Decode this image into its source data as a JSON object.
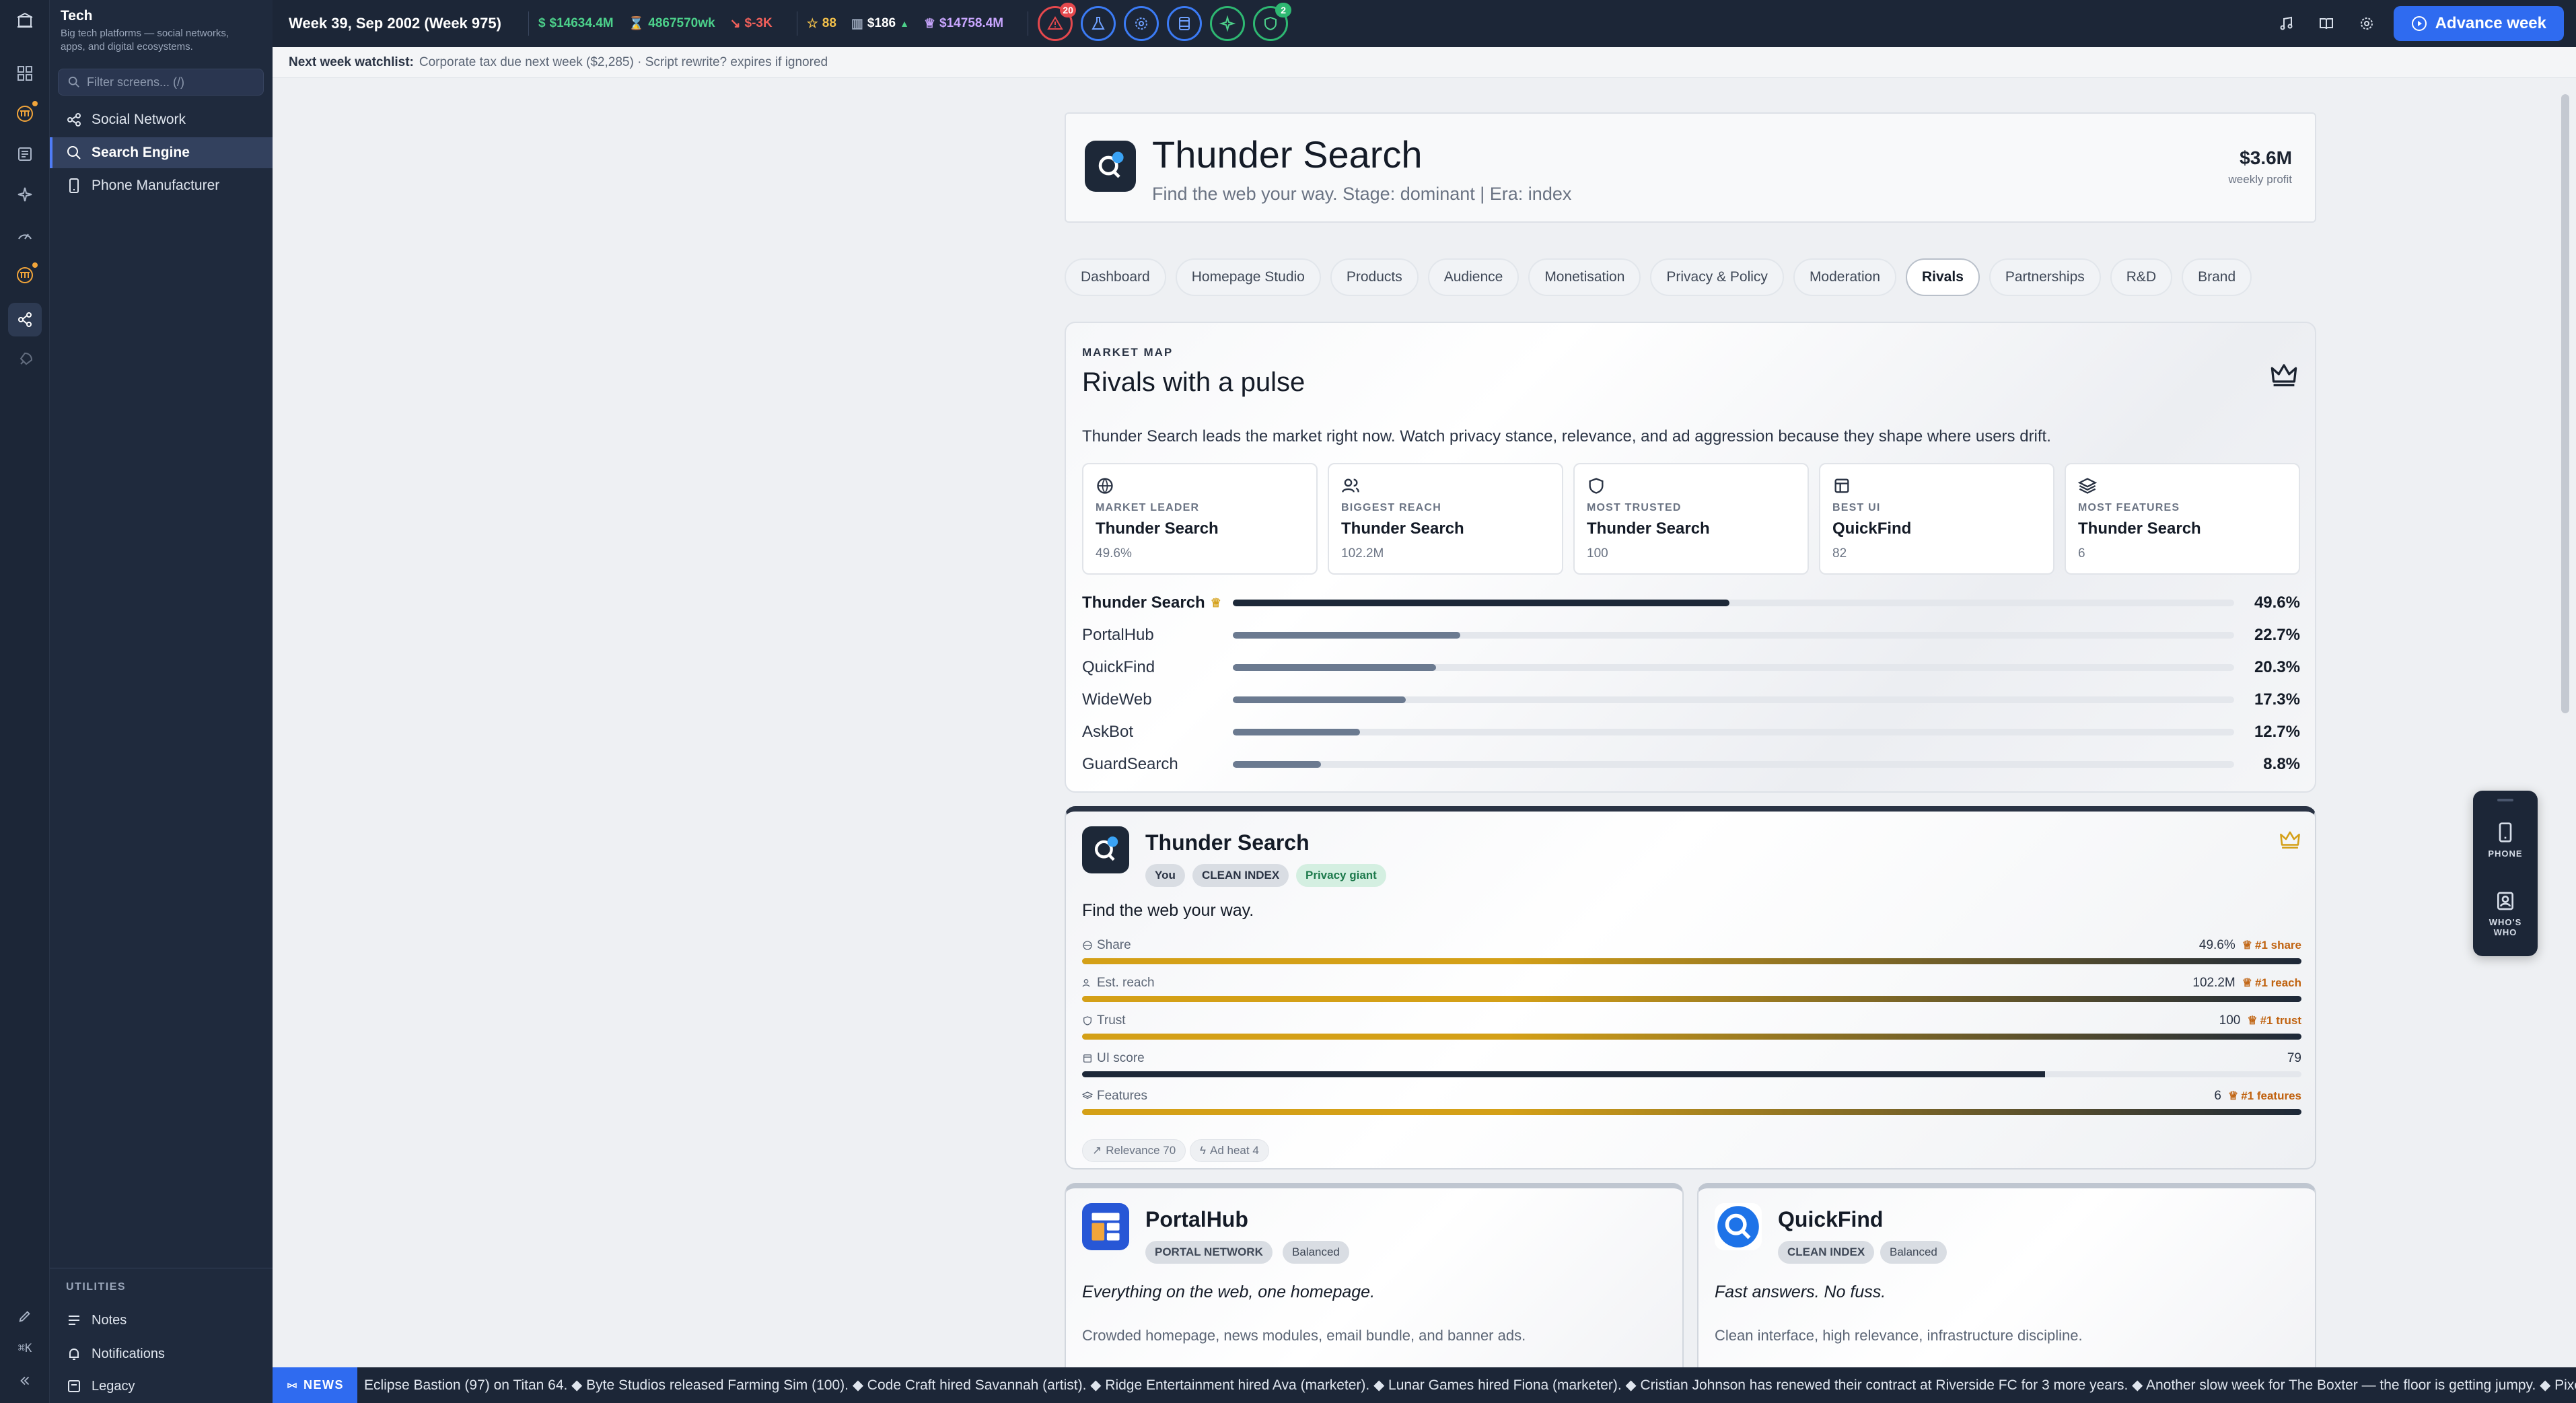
{
  "sidebar": {
    "title": "Tech",
    "subtitle": "Big tech platforms — social networks, apps, and digital ecosystems.",
    "filter_placeholder": "Filter screens... (/)",
    "items": [
      {
        "label": "Social Network",
        "icon": "share-icon"
      },
      {
        "label": "Search Engine",
        "icon": "search-icon",
        "active": true
      },
      {
        "label": "Phone Manufacturer",
        "icon": "phone-icon"
      }
    ],
    "utilities_label": "UTILITIES",
    "utilities": [
      {
        "label": "Notes",
        "icon": "notes-icon"
      },
      {
        "label": "Notifications",
        "icon": "bell-icon"
      },
      {
        "label": "Legacy",
        "icon": "legacy-icon"
      }
    ],
    "shortcut": "⌘K"
  },
  "topbar": {
    "week": "Week 39, Sep 2002 (Week 975)",
    "cash": "$14634.4M",
    "rate": "4867570wk",
    "delta": "$-3K",
    "stars": "88",
    "stock": "$186",
    "networth": "$14758.4M",
    "alerts_count": "20",
    "shield_count": "2",
    "advance_label": "Advance week"
  },
  "watchlist": {
    "label": "Next week watchlist:",
    "text": "Corporate tax due next week ($2,285) · Script rewrite? expires if ignored"
  },
  "company": {
    "name": "Thunder Search",
    "subtitle": "Find the web your way. Stage: dominant | Era: index",
    "profit": "$3.6M",
    "profit_label": "weekly profit"
  },
  "tabs": [
    "Dashboard",
    "Homepage Studio",
    "Products",
    "Audience",
    "Monetisation",
    "Privacy & Policy",
    "Moderation",
    "Rivals",
    "Partnerships",
    "R&D",
    "Brand"
  ],
  "active_tab": "Rivals",
  "market_map": {
    "eyebrow": "MARKET MAP",
    "title": "Rivals with a pulse",
    "description": "Thunder Search leads the market right now. Watch privacy stance, relevance, and ad aggression because they shape where users drift.",
    "leaders": [
      {
        "label": "MARKET LEADER",
        "name": "Thunder Search",
        "value": "49.6%",
        "icon": "globe-icon"
      },
      {
        "label": "BIGGEST REACH",
        "name": "Thunder Search",
        "value": "102.2M",
        "icon": "users-icon"
      },
      {
        "label": "MOST TRUSTED",
        "name": "Thunder Search",
        "value": "100",
        "icon": "shield-icon"
      },
      {
        "label": "BEST UI",
        "name": "QuickFind",
        "value": "82",
        "icon": "layout-icon"
      },
      {
        "label": "MOST FEATURES",
        "name": "Thunder Search",
        "value": "6",
        "icon": "layers-icon"
      }
    ],
    "shares": [
      {
        "name": "Thunder Search",
        "pct_label": "49.6%",
        "pct": 49.6,
        "top": true
      },
      {
        "name": "PortalHub",
        "pct_label": "22.7%",
        "pct": 22.7
      },
      {
        "name": "QuickFind",
        "pct_label": "20.3%",
        "pct": 20.3
      },
      {
        "name": "WideWeb",
        "pct_label": "17.3%",
        "pct": 17.3
      },
      {
        "name": "AskBot",
        "pct_label": "12.7%",
        "pct": 12.7
      },
      {
        "name": "GuardSearch",
        "pct_label": "8.8%",
        "pct": 8.8
      }
    ]
  },
  "rival_detail": {
    "name": "Thunder Search",
    "badge_you": "You",
    "badge_type": "CLEAN INDEX",
    "badge_stance": "Privacy giant",
    "tagline": "Find the web your way.",
    "metrics": [
      {
        "label": "Share",
        "value": "49.6%",
        "rank": "#1 share",
        "fill": 1.0,
        "gold": true,
        "icon": "globe-icon"
      },
      {
        "label": "Est. reach",
        "value": "102.2M",
        "rank": "#1 reach",
        "fill": 1.0,
        "gold": true,
        "icon": "users-icon"
      },
      {
        "label": "Trust",
        "value": "100",
        "rank": "#1 trust",
        "fill": 1.0,
        "gold": true,
        "icon": "shield-icon"
      },
      {
        "label": "UI score",
        "value": "79",
        "rank": "",
        "fill": 0.79,
        "gold": false,
        "icon": "layout-icon"
      },
      {
        "label": "Features",
        "value": "6",
        "rank": "#1 features",
        "fill": 1.0,
        "gold": true,
        "icon": "layers-icon"
      }
    ],
    "chips": [
      "Relevance 70",
      "Ad heat 4"
    ]
  },
  "rivals": [
    {
      "name": "PortalHub",
      "type": "PORTAL NETWORK",
      "stance": "Balanced",
      "tagline": "Everything on the web, one homepage.",
      "desc": "Crowded homepage, news modules, email bundle, and banner ads."
    },
    {
      "name": "QuickFind",
      "type": "CLEAN INDEX",
      "stance": "Balanced",
      "tagline": "Fast answers. No fuss.",
      "desc": "Clean interface, high relevance, infrastructure discipline."
    }
  ],
  "widget": {
    "phone_label": "PHONE",
    "whos_label": "WHO'S WHO"
  },
  "news": {
    "badge": "NEWS",
    "text": "Eclipse Bastion (97) on Titan 64. ◆ Byte Studios released Farming Sim (100). ◆ Code Craft hired Savannah (artist). ◆ Ridge Entertainment hired Ava (marketer). ◆ Lunar Games hired Fiona (marketer). ◆ Cristian Johnson has renewed their contract at Riverside FC for 3 more years. ◆ Another slow week for The Boxter — the floor is getting jumpy. ◆ Pixel Forge jumps after hit Puzzle rele"
  },
  "colors": {
    "gold": "#d4a017",
    "navy": "#1d2838",
    "accent": "#2f6bf0"
  }
}
